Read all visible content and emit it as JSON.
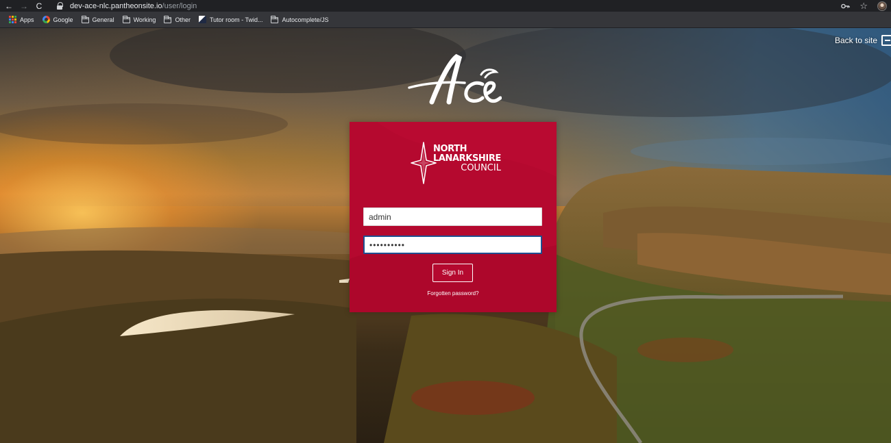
{
  "browser": {
    "nav": {
      "back": "←",
      "forward": "→",
      "reload": "C"
    },
    "url_host": "dev-ace-nlc.pantheonsite.io",
    "url_path": "/user/login",
    "icons": {
      "key": "key-icon",
      "star": "☆"
    }
  },
  "bookmarks": [
    {
      "label": "Apps",
      "icon": "apps-grid-icon"
    },
    {
      "label": "Google",
      "icon": "google-icon"
    },
    {
      "label": "General",
      "icon": "folder-icon"
    },
    {
      "label": "Working",
      "icon": "folder-icon"
    },
    {
      "label": "Other",
      "icon": "folder-icon"
    },
    {
      "label": "Tutor room - Twid...",
      "icon": "site-icon"
    },
    {
      "label": "Autocomplete/JS",
      "icon": "folder-icon"
    }
  ],
  "header": {
    "back_to_site": "Back to site",
    "logo_text": "Ace"
  },
  "login": {
    "council_line1": "NORTH",
    "council_line2": "LANARKSHIRE",
    "council_line3": "COUNCIL",
    "username_value": "admin",
    "password_value": "••••••••••",
    "signin_label": "Sign In",
    "forgot_label": "Forgotten password?"
  },
  "colors": {
    "card": "#b5092f",
    "chrome_dark": "#202124",
    "bookmarks_bar": "#35363a",
    "focus_border": "#1d4f91"
  }
}
